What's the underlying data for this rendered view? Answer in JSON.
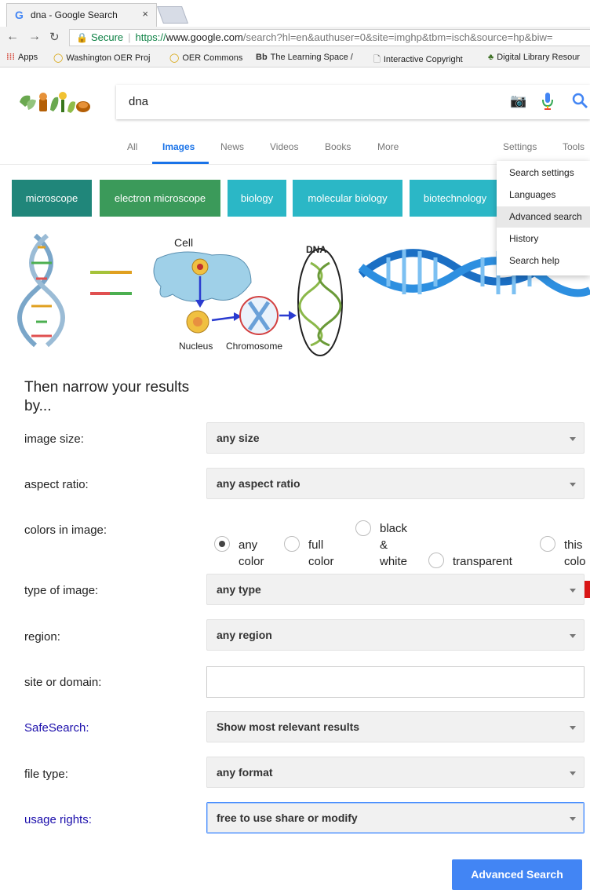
{
  "browser": {
    "tab_title": "dna - Google Search",
    "tab_favicon": "G",
    "tab_close": "×",
    "secure_label": "Secure",
    "url_protocol": "https://",
    "url_host": "www.google.com",
    "url_rest": "/search?hl=en&authuser=0&site=imghp&tbm=isch&source=hp&biw=",
    "bookmarks": [
      {
        "label": "Apps"
      },
      {
        "label": "Washington OER Proj"
      },
      {
        "label": "OER Commons"
      },
      {
        "label": "The Learning Space /"
      },
      {
        "label": "Interactive Copyright"
      },
      {
        "label": "Digital Library Resour"
      }
    ],
    "bb_glyph": "Bb"
  },
  "search": {
    "query": "dna"
  },
  "nav": {
    "tabs": [
      "All",
      "Images",
      "News",
      "Videos",
      "Books",
      "More"
    ],
    "settings": "Settings",
    "tools": "Tools"
  },
  "chips": [
    {
      "label": "microscope",
      "color": "#20867a"
    },
    {
      "label": "electron microscope",
      "color": "#3b9a5a"
    },
    {
      "label": "biology",
      "color": "#2bb7c6"
    },
    {
      "label": "molecular biology",
      "color": "#2bb7c6"
    },
    {
      "label": "biotechnology",
      "color": "#2bb7c6"
    }
  ],
  "settings_menu": {
    "items": [
      "Search settings",
      "Languages",
      "Advanced search",
      "History",
      "Search help"
    ],
    "highlighted": "Advanced search"
  },
  "images": {
    "diagram_labels": {
      "cell": "Cell",
      "dna": "DNA",
      "nucleus": "Nucleus",
      "chromosome": "Chromosome"
    }
  },
  "advanced": {
    "title": "Then narrow your results by...",
    "rows": {
      "image_size": {
        "label": "image size:",
        "value": "any size"
      },
      "aspect_ratio": {
        "label": "aspect ratio:",
        "value": "any aspect ratio"
      },
      "colors": {
        "label": "colors in image:"
      },
      "type": {
        "label": "type of image:",
        "value": "any type"
      },
      "region": {
        "label": "region:",
        "value": "any region"
      },
      "site": {
        "label": "site or domain:"
      },
      "safesearch": {
        "label": "SafeSearch:",
        "value": "Show most relevant results"
      },
      "file_type": {
        "label": "file type:",
        "value": "any format"
      },
      "usage_rights": {
        "label": "usage rights:",
        "value": "free to use share or modify"
      }
    },
    "color_options": {
      "any": [
        "any",
        "color"
      ],
      "full": [
        "full",
        "color"
      ],
      "bw": [
        "black",
        "&",
        "white"
      ],
      "transparent": "transparent",
      "this": [
        "this",
        "colo"
      ]
    },
    "color_selected": "any",
    "submit": "Advanced Search"
  },
  "colors": {
    "link_blue": "#1a0dab",
    "accent_blue": "#4285f4",
    "secure_green": "#0b8043"
  }
}
